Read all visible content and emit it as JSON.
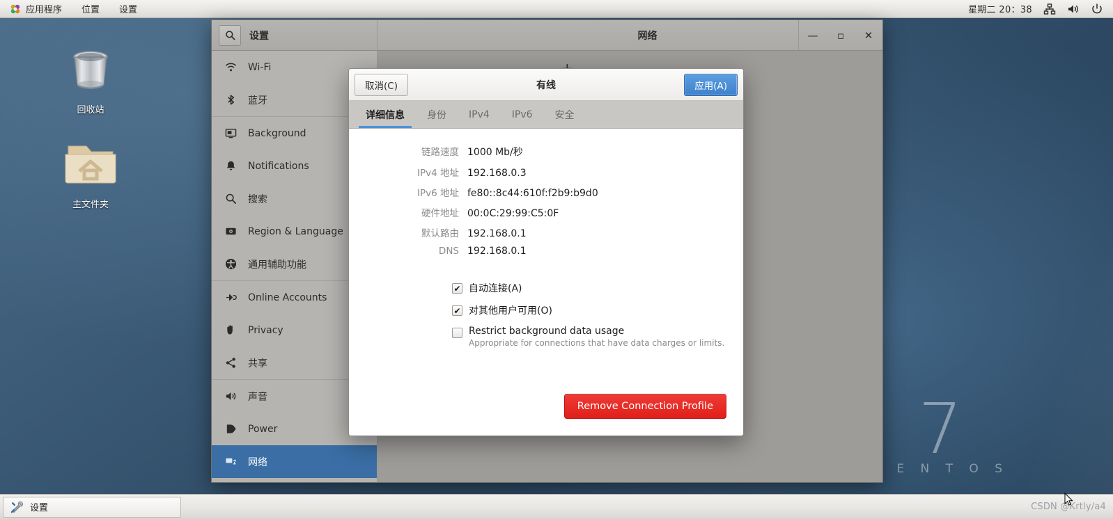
{
  "top_panel": {
    "apps_label": "应用程序",
    "places_label": "位置",
    "settings_label": "设置",
    "apps_icon": "gnome-foot-icon",
    "clock": "星期二  20：38",
    "tray": [
      {
        "name": "network-icon"
      },
      {
        "name": "volume-icon"
      },
      {
        "name": "power-icon"
      }
    ]
  },
  "desktop": {
    "icons": [
      {
        "name": "trash-icon",
        "label": "回收站"
      },
      {
        "name": "home-folder-icon",
        "label": "主文件夹"
      }
    ],
    "watermark": {
      "version": "7",
      "word": "C E N T O S"
    }
  },
  "bottom_panel": {
    "task_button": {
      "label": "设置",
      "icon": "tools-icon"
    },
    "watermark": "CSDN @Krtly/a4"
  },
  "settings_window": {
    "left_title": "设置",
    "main_title": "网络",
    "search_icon": "search-icon",
    "window_controls": [
      {
        "name": "minimize-button",
        "glyph": "—"
      },
      {
        "name": "maximize-button",
        "glyph": "▫"
      },
      {
        "name": "close-button",
        "glyph": "✕"
      }
    ],
    "sidebar": [
      {
        "label": "Wi-Fi",
        "icon": "wifi-icon",
        "selected": false,
        "sep_after": false
      },
      {
        "label": "蓝牙",
        "icon": "bluetooth-icon",
        "selected": false,
        "sep_after": true
      },
      {
        "label": "Background",
        "icon": "background-icon",
        "selected": false,
        "sep_after": false
      },
      {
        "label": "Notifications",
        "icon": "bell-icon",
        "selected": false,
        "sep_after": false
      },
      {
        "label": "搜索",
        "icon": "search-icon",
        "selected": false,
        "sep_after": false
      },
      {
        "label": "Region & Language",
        "icon": "region-language-icon",
        "selected": false,
        "sep_after": false
      },
      {
        "label": "通用辅助功能",
        "icon": "accessibility-icon",
        "selected": false,
        "sep_after": true
      },
      {
        "label": "Online Accounts",
        "icon": "online-accounts-icon",
        "selected": false,
        "sep_after": false
      },
      {
        "label": "Privacy",
        "icon": "privacy-hand-icon",
        "selected": false,
        "sep_after": false
      },
      {
        "label": "共享",
        "icon": "share-icon",
        "selected": false,
        "sep_after": true
      },
      {
        "label": "声音",
        "icon": "sound-icon",
        "selected": false,
        "sep_after": false
      },
      {
        "label": "Power",
        "icon": "power-plug-icon",
        "selected": false,
        "sep_after": false
      },
      {
        "label": "网络",
        "icon": "network-icon",
        "selected": true,
        "sep_after": false
      }
    ]
  },
  "dialog": {
    "cancel_label": "取消(C)",
    "title": "有线",
    "apply_label": "应用(A)",
    "tabs": [
      {
        "label": "详细信息",
        "active": true
      },
      {
        "label": "身份",
        "active": false
      },
      {
        "label": "IPv4",
        "active": false
      },
      {
        "label": "IPv6",
        "active": false
      },
      {
        "label": "安全",
        "active": false
      }
    ],
    "details": [
      {
        "label": "链路速度",
        "value": "1000 Mb/秒"
      },
      {
        "label": "IPv4 地址",
        "value": "192.168.0.3"
      },
      {
        "label": "IPv6 地址",
        "value": "fe80::8c44:610f:f2b9:b9d0"
      },
      {
        "label": "硬件地址",
        "value": "00:0C:29:99:C5:0F"
      },
      {
        "label": "默认路由",
        "value": "192.168.0.1"
      },
      {
        "label": "DNS",
        "value": "192.168.0.1"
      }
    ],
    "checkboxes": [
      {
        "label": "自动连接(A)",
        "sub": "",
        "checked": true
      },
      {
        "label": "对其他用户可用(O)",
        "sub": "",
        "checked": true
      },
      {
        "label": "Restrict background data usage",
        "sub": "Appropriate for connections that have data charges or limits.",
        "checked": false
      }
    ],
    "remove_label": "Remove Connection Profile"
  },
  "colors": {
    "accent_blue": "#4a90d9",
    "selected_blue": "#3a6ea5",
    "danger_red": "#e01f19",
    "panel_grey": "#b6b4b1"
  }
}
